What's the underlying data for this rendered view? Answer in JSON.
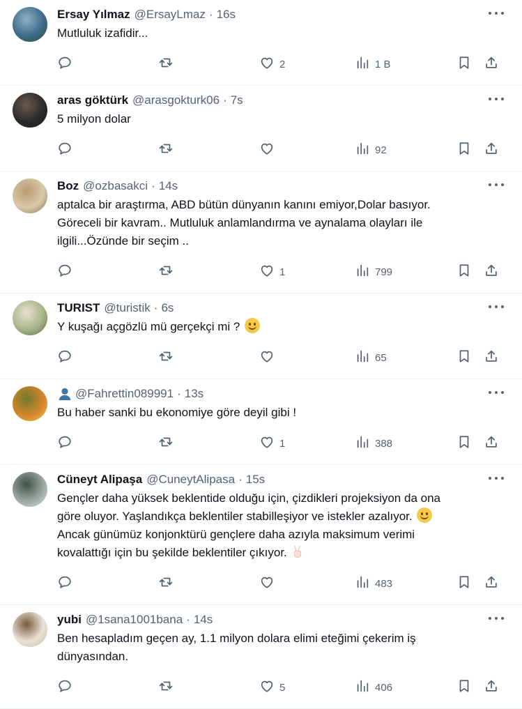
{
  "tweets": [
    {
      "name": "Ersay Yılmaz",
      "handle": "@ErsayLmaz",
      "time": "16s",
      "lines": [
        "Mutluluk izafidir..."
      ],
      "likes": "2",
      "views": "1 B",
      "avatar_colors": [
        "#3d6b8a",
        "#8fb0c4",
        "#2e4a2e"
      ]
    },
    {
      "name": "aras göktürk",
      "handle": "@arasgokturk06",
      "time": "7s",
      "lines": [
        "5 milyon dolar"
      ],
      "likes": "",
      "views": "92",
      "avatar_colors": [
        "#2b2b2b",
        "#6b5a4d",
        "#1a1a1a"
      ]
    },
    {
      "name": "Boz",
      "handle": "@ozbasakci",
      "time": "14s",
      "lines": [
        "aptalca bir araştırma, ABD bütün dünyanın kanını emiyor,Dolar basıyor.",
        "Göreceli bir kavram.. Mutluluk anlamlandırma ve aynalama olayları ile",
        "ilgili...Özünde bir seçim .."
      ],
      "likes": "1",
      "views": "799",
      "avatar_colors": [
        "#d9c9a8",
        "#b89b72",
        "#8a7456"
      ]
    },
    {
      "name": "TURIST",
      "handle": "@turistik",
      "time": "6s",
      "lines": [
        "Y kuşağı açgözlü mü gerçekçi mi ?"
      ],
      "emoji_after": true,
      "likes": "",
      "views": "65",
      "avatar_colors": [
        "#a7b58a",
        "#e8e0d0",
        "#5b6b44"
      ]
    },
    {
      "name": "",
      "handle": "@Fahrettin089991",
      "time": "13s",
      "show_person_icon": true,
      "lines": [
        "Bu haber sanki bu ekonomiye göre deyil gibi !"
      ],
      "likes": "1",
      "views": "388",
      "avatar_colors": [
        "#d4852a",
        "#6e7a2e",
        "#f1c05a"
      ]
    },
    {
      "name": "Cüneyt Alipaşa",
      "handle": "@CuneytAlipasa",
      "time": "15s",
      "lines": [
        "Gençler daha yüksek beklentide olduğu için, çizdikleri projeksiyon da ona",
        "göre oluyor. Yaşlandıkça beklentiler stabilleşiyor ve istekler azalıyor.",
        "Ancak günümüz konjonktürü gençlere daha azıyla maksimum verimi",
        "kovalattığı için bu şekilde beklentiler çıkıyor."
      ],
      "emoji_line": 1,
      "hand_line": 3,
      "likes": "",
      "views": "483",
      "avatar_colors": [
        "#9aa8a0",
        "#3e5143",
        "#d8dde0"
      ]
    },
    {
      "name": "yubi",
      "handle": "@1sana1001bana",
      "time": "14s",
      "lines": [
        "Ben hesapladım geçen ay, 1.1 milyon dolara elimi eteğimi çekerim iş",
        "dünyasından."
      ],
      "likes": "5",
      "views": "406",
      "avatar_colors": [
        "#e9e2d6",
        "#7a5a3a",
        "#c9b79c"
      ]
    }
  ],
  "icons": {
    "reply": "reply-icon",
    "retweet": "retweet-icon",
    "like": "heart-icon",
    "views": "views-icon",
    "bookmark": "bookmark-icon",
    "share": "share-icon",
    "more": "more-icon"
  },
  "colors": {
    "text": "#0f1419",
    "secondary": "#536471",
    "divider": "#eff3f4"
  }
}
